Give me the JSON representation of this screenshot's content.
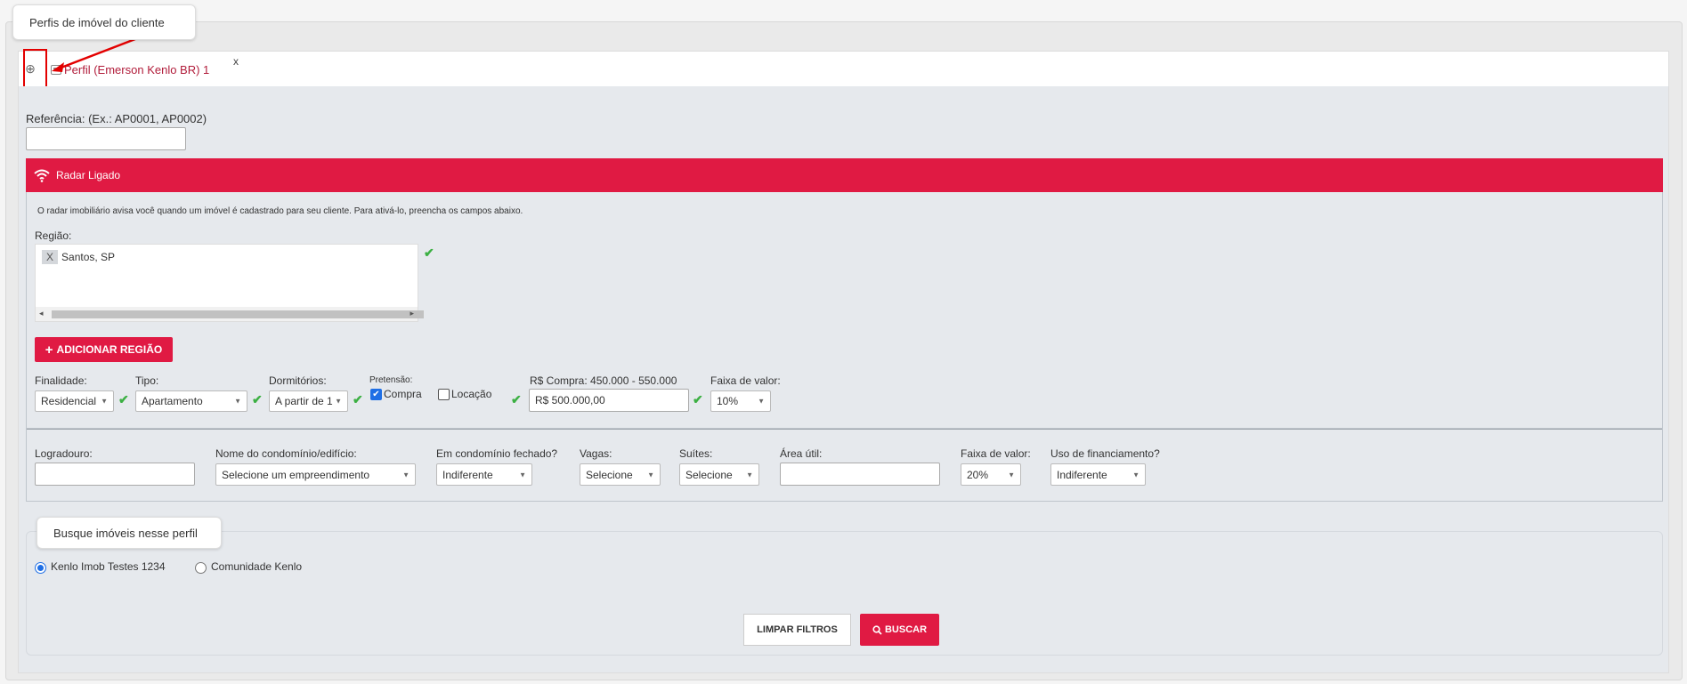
{
  "tooltips": {
    "profiles": "Perfis de imóvel do cliente",
    "search": "Busque imóveis nesse perfil"
  },
  "tabs": {
    "add_symbol": "⊕",
    "active_tab_label": "Perfil (Emerson Kenlo BR) 1",
    "close_label": "x"
  },
  "reference": {
    "label": "Referência: (Ex.: AP0001, AP0002)",
    "value": ""
  },
  "radar": {
    "header": "Radar Ligado",
    "description": "O radar imobiliário avisa você quando um imóvel é cadastrado para seu cliente. Para ativá-lo, preencha os campos abaixo.",
    "region_label": "Região:",
    "regions": [
      "Santos, SP"
    ],
    "chip_remove": "X",
    "add_region_button": "ADICIONAR REGIÃO",
    "add_region_icon": "+"
  },
  "criteria": {
    "finalidade_label": "Finalidade:",
    "finalidade_value": "Residencial",
    "tipo_label": "Tipo:",
    "tipo_value": "Apartamento",
    "dormitorios_label": "Dormitórios:",
    "dormitorios_value": "A partir de 1",
    "pretensao_label": "Pretensão:",
    "compra_label": "Compra",
    "compra_checked": true,
    "locacao_label": "Locação",
    "locacao_checked": false,
    "compra_range_label": "R$ Compra: 450.000 - 550.000",
    "compra_value": "R$ 500.000,00",
    "faixa_label": "Faixa de valor:",
    "faixa_value": "10%"
  },
  "filters": {
    "logradouro_label": "Logradouro:",
    "logradouro_value": "",
    "condominio_label": "Nome do condomínio/edifício:",
    "condominio_value": "Selecione um empreendimento",
    "fechado_label": "Em condomínio fechado?",
    "fechado_value": "Indiferente",
    "vagas_label": "Vagas:",
    "vagas_value": "Selecione",
    "suites_label": "Suítes:",
    "suites_value": "Selecione",
    "area_label": "Área útil:",
    "area_value": "",
    "faixa_label": "Faixa de valor:",
    "faixa_value": "20%",
    "financiamento_label": "Uso de financiamento?",
    "financiamento_value": "Indiferente"
  },
  "search": {
    "option1": "Kenlo Imob Testes 1234",
    "option2": "Comunidade Kenlo",
    "selected": "option1",
    "clear_button": "LIMPAR FILTROS",
    "search_button": "BUSCAR"
  },
  "colors": {
    "accent_red": "#e01a43",
    "check_green": "#3cb043",
    "annotation_red": "#e30000"
  }
}
